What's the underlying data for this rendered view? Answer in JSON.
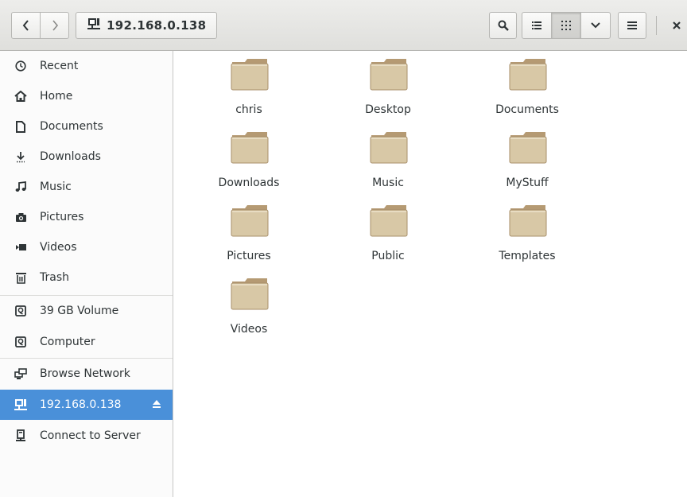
{
  "header": {
    "path_label": "192.168.0.138",
    "icons": [
      "back-icon",
      "forward-icon",
      "network-computer-icon",
      "search-icon",
      "list-view-icon",
      "grid-view-icon",
      "chevron-down-icon",
      "hamburger-menu-icon",
      "close-icon"
    ]
  },
  "sidebar": {
    "items": [
      {
        "label": "Recent",
        "icon": "clock-icon"
      },
      {
        "label": "Home",
        "icon": "home-icon"
      },
      {
        "label": "Documents",
        "icon": "document-icon"
      },
      {
        "label": "Downloads",
        "icon": "download-icon"
      },
      {
        "label": "Music",
        "icon": "music-icon"
      },
      {
        "label": "Pictures",
        "icon": "camera-icon"
      },
      {
        "label": "Videos",
        "icon": "video-icon"
      },
      {
        "label": "Trash",
        "icon": "trash-icon"
      },
      {
        "label": "39 GB Volume",
        "icon": "drive-icon"
      },
      {
        "label": "Computer",
        "icon": "drive-icon"
      },
      {
        "label": "Browse Network",
        "icon": "network-icon"
      },
      {
        "label": "192.168.0.138",
        "icon": "network-computer-icon",
        "active": true
      },
      {
        "label": "Connect to Server",
        "icon": "server-icon"
      }
    ]
  },
  "files": [
    {
      "name": "chris"
    },
    {
      "name": "Desktop"
    },
    {
      "name": "Documents"
    },
    {
      "name": "Downloads"
    },
    {
      "name": "Music"
    },
    {
      "name": "MyStuff"
    },
    {
      "name": "Pictures"
    },
    {
      "name": "Public"
    },
    {
      "name": "Templates"
    },
    {
      "name": "Videos"
    }
  ],
  "colors": {
    "accent": "#4a90d9",
    "folder": "#d8c8a6"
  }
}
